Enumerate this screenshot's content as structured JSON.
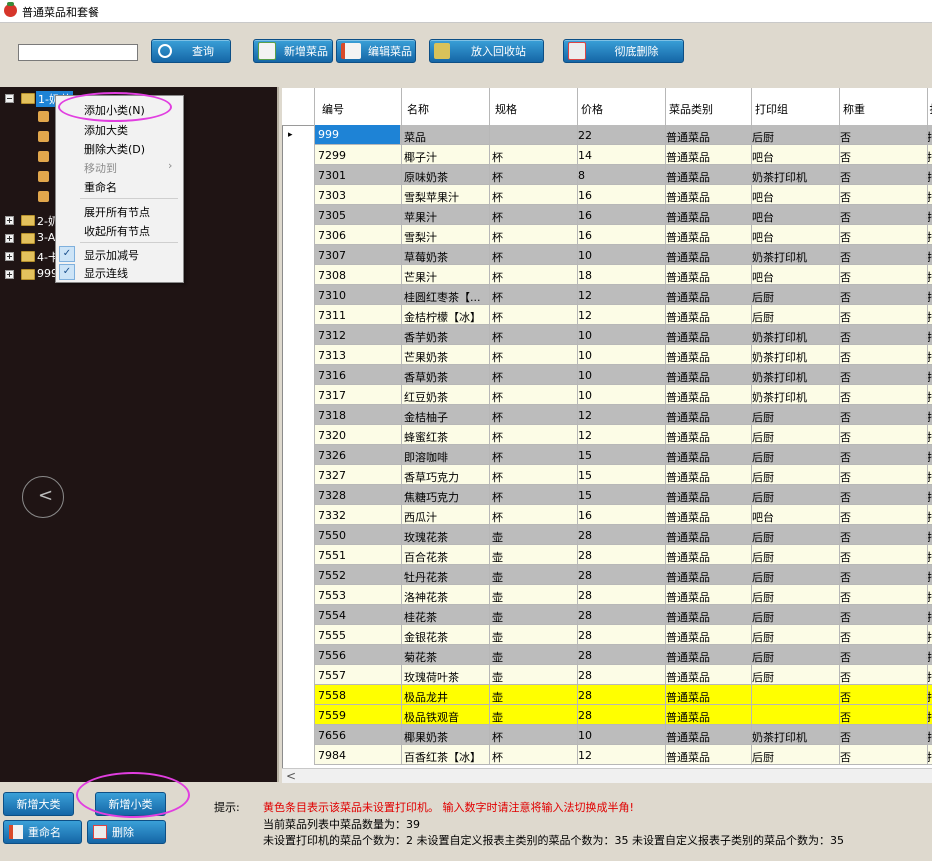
{
  "window": {
    "title": "普通菜品和套餐"
  },
  "toolbar": {
    "search_value": "",
    "query": "查询",
    "add_dish": "新增菜品",
    "edit_dish": "编辑菜品",
    "recycle": "放入回收站",
    "delete_all": "彻底删除"
  },
  "tree": {
    "nodes": [
      "1-奶茶",
      "2-奶",
      "3-A",
      "4-卡",
      "999"
    ]
  },
  "context_menu": {
    "items": [
      "添加小类(N)",
      "添加大类",
      "删除大类(D)",
      "移动到",
      "重命名",
      "展开所有节点",
      "收起所有节点",
      "显示加减号",
      "显示连线"
    ],
    "disabled": [
      "移动到"
    ],
    "checked": [
      "显示加减号",
      "显示连线"
    ],
    "submenu_arrow": "›"
  },
  "table": {
    "columns": [
      "编号",
      "名称",
      "规格",
      "价格",
      "菜品类别",
      "打印组",
      "称重",
      "扌"
    ],
    "rows": [
      [
        "999",
        "菜品",
        "",
        "22",
        "普通菜品",
        "后厨",
        "否",
        "扌"
      ],
      [
        "7299",
        "椰子汁",
        "杯",
        "14",
        "普通菜品",
        "吧台",
        "否",
        "扌"
      ],
      [
        "7301",
        "原味奶茶",
        "杯",
        "8",
        "普通菜品",
        "奶茶打印机",
        "否",
        "扌"
      ],
      [
        "7303",
        "雪梨苹果汁",
        "杯",
        "16",
        "普通菜品",
        "吧台",
        "否",
        "扌"
      ],
      [
        "7305",
        "苹果汁",
        "杯",
        "16",
        "普通菜品",
        "吧台",
        "否",
        "扌"
      ],
      [
        "7306",
        "雪梨汁",
        "杯",
        "16",
        "普通菜品",
        "吧台",
        "否",
        "扌"
      ],
      [
        "7307",
        "草莓奶茶",
        "杯",
        "10",
        "普通菜品",
        "奶茶打印机",
        "否",
        "扌"
      ],
      [
        "7308",
        "芒果汁",
        "杯",
        "18",
        "普通菜品",
        "吧台",
        "否",
        "扌"
      ],
      [
        "7310",
        "桂圆红枣茶【...",
        "杯",
        "12",
        "普通菜品",
        "后厨",
        "否",
        "扌"
      ],
      [
        "7311",
        "金桔柠檬【冰】",
        "杯",
        "12",
        "普通菜品",
        "后厨",
        "否",
        "扌"
      ],
      [
        "7312",
        "香芋奶茶",
        "杯",
        "10",
        "普通菜品",
        "奶茶打印机",
        "否",
        "扌"
      ],
      [
        "7313",
        "芒果奶茶",
        "杯",
        "10",
        "普通菜品",
        "奶茶打印机",
        "否",
        "扌"
      ],
      [
        "7316",
        "香草奶茶",
        "杯",
        "10",
        "普通菜品",
        "奶茶打印机",
        "否",
        "扌"
      ],
      [
        "7317",
        "红豆奶茶",
        "杯",
        "10",
        "普通菜品",
        "奶茶打印机",
        "否",
        "扌"
      ],
      [
        "7318",
        "金桔柚子",
        "杯",
        "12",
        "普通菜品",
        "后厨",
        "否",
        "扌"
      ],
      [
        "7320",
        "蜂蜜红茶",
        "杯",
        "12",
        "普通菜品",
        "后厨",
        "否",
        "扌"
      ],
      [
        "7326",
        "即溶咖啡",
        "杯",
        "15",
        "普通菜品",
        "后厨",
        "否",
        "扌"
      ],
      [
        "7327",
        "香草巧克力",
        "杯",
        "15",
        "普通菜品",
        "后厨",
        "否",
        "扌"
      ],
      [
        "7328",
        "焦糖巧克力",
        "杯",
        "15",
        "普通菜品",
        "后厨",
        "否",
        "扌"
      ],
      [
        "7332",
        "西瓜汁",
        "杯",
        "16",
        "普通菜品",
        "吧台",
        "否",
        "扌"
      ],
      [
        "7550",
        "玫瑰花茶",
        "壶",
        "28",
        "普通菜品",
        "后厨",
        "否",
        "扌"
      ],
      [
        "7551",
        "百合花茶",
        "壶",
        "28",
        "普通菜品",
        "后厨",
        "否",
        "扌"
      ],
      [
        "7552",
        "牡丹花茶",
        "壶",
        "28",
        "普通菜品",
        "后厨",
        "否",
        "扌"
      ],
      [
        "7553",
        "洛神花茶",
        "壶",
        "28",
        "普通菜品",
        "后厨",
        "否",
        "扌"
      ],
      [
        "7554",
        "桂花茶",
        "壶",
        "28",
        "普通菜品",
        "后厨",
        "否",
        "扌"
      ],
      [
        "7555",
        "金银花茶",
        "壶",
        "28",
        "普通菜品",
        "后厨",
        "否",
        "扌"
      ],
      [
        "7556",
        "菊花茶",
        "壶",
        "28",
        "普通菜品",
        "后厨",
        "否",
        "扌"
      ],
      [
        "7557",
        "玫瑰荷叶茶",
        "壶",
        "28",
        "普通菜品",
        "后厨",
        "否",
        "扌"
      ],
      [
        "7558",
        "极品龙井",
        "壶",
        "28",
        "普通菜品",
        "",
        "否",
        "扌"
      ],
      [
        "7559",
        "极品铁观音",
        "壶",
        "28",
        "普通菜品",
        "",
        "否",
        "扌"
      ],
      [
        "7656",
        "椰果奶茶",
        "杯",
        "10",
        "普通菜品",
        "奶茶打印机",
        "否",
        "扌"
      ],
      [
        "7984",
        "百香红茶【冰】",
        "杯",
        "12",
        "普通菜品",
        "后厨",
        "否",
        "扌"
      ]
    ],
    "current_row_marker": "▸",
    "scroll_left_arrow": "<"
  },
  "bottom": {
    "add_major": "新增大类",
    "add_minor": "新增小类",
    "rename": "重命名",
    "delete": "删除",
    "hint_label": "提示:",
    "hint_text": "黄色条目表示该菜品未设置打印机。 输入数字时请注意将输入法切换成半角!",
    "count_text": "当前菜品列表中菜品数量为：39",
    "stats_text": "未设置打印机的菜品个数为：2   未设置自定义报表主类别的菜品个数为：35   未设置自定义报表子类别的菜品个数为：35"
  },
  "colors": {
    "row_gray": "#bcbcbc",
    "row_cream": "#fcfce6",
    "row_yellow": "#ffff00",
    "selected": "#1e83d6",
    "hint_red": "#e00000",
    "highlight": "#e13ee0"
  }
}
